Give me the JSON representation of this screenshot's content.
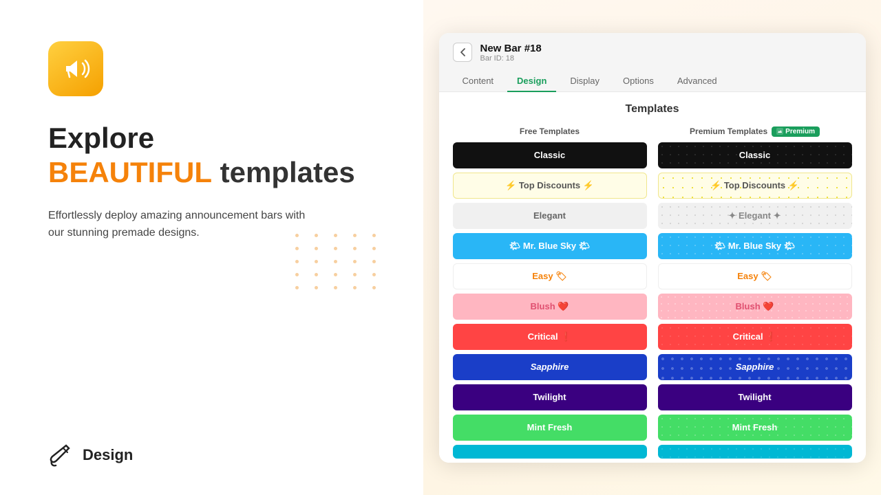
{
  "left": {
    "hero_line1": "Explore",
    "hero_highlight": "BEAUTIFUL",
    "hero_line2_rest": " templates",
    "hero_desc": "Effortlessly deploy amazing announcement bars with our stunning premade designs.",
    "design_label": "Design"
  },
  "window": {
    "title": "New Bar #18",
    "subtitle": "Bar ID: 18",
    "tabs": [
      {
        "label": "Content",
        "active": false
      },
      {
        "label": "Design",
        "active": true
      },
      {
        "label": "Display",
        "active": false
      },
      {
        "label": "Options",
        "active": false
      },
      {
        "label": "Advanced",
        "active": false
      }
    ],
    "templates_title": "Templates",
    "free_col_header": "Free Templates",
    "premium_col_header": "Premium Templates",
    "premium_badge_label": "Premium",
    "free_templates": [
      {
        "label": "Classic",
        "class": "t-classic-free"
      },
      {
        "label": "⚡ Top Discounts ⚡",
        "class": "t-topdiscounts-free"
      },
      {
        "label": "Elegant",
        "class": "t-elegant-free"
      },
      {
        "label": "🌤 Mr. Blue Sky 🌤",
        "class": "t-mrbluesky-free"
      },
      {
        "label": "Easy 🏷",
        "class": "t-easy-free"
      },
      {
        "label": "Blush ❤",
        "class": "t-blush-free"
      },
      {
        "label": "Critical ❗",
        "class": "t-critical-free"
      },
      {
        "label": "Sapphire",
        "class": "t-sapphire-free"
      },
      {
        "label": "Twilight",
        "class": "t-twilight-free"
      },
      {
        "label": "Mint Fresh",
        "class": "t-mintfresh-free"
      },
      {
        "label": "...",
        "class": "t-more-free"
      }
    ],
    "premium_templates": [
      {
        "label": "Classic",
        "class": "t-classic-prem"
      },
      {
        "label": "⚡ Top Discounts ⚡",
        "class": "t-topdiscounts-prem"
      },
      {
        "label": "✦ Elegant ✦",
        "class": "t-elegant-prem"
      },
      {
        "label": "🌤 Mr. Blue Sky 🌤",
        "class": "t-mrbluesky-prem"
      },
      {
        "label": "Easy 🏷",
        "class": "t-easy-prem"
      },
      {
        "label": "Blush ❤",
        "class": "t-blush-prem"
      },
      {
        "label": "Critical ❗",
        "class": "t-critical-prem"
      },
      {
        "label": "Sapphire",
        "class": "t-sapphire-prem"
      },
      {
        "label": "Twilight",
        "class": "t-twilight-prem"
      },
      {
        "label": "Mint Fresh",
        "class": "t-mintfresh-prem"
      },
      {
        "label": "...",
        "class": "t-more-prem"
      }
    ]
  }
}
